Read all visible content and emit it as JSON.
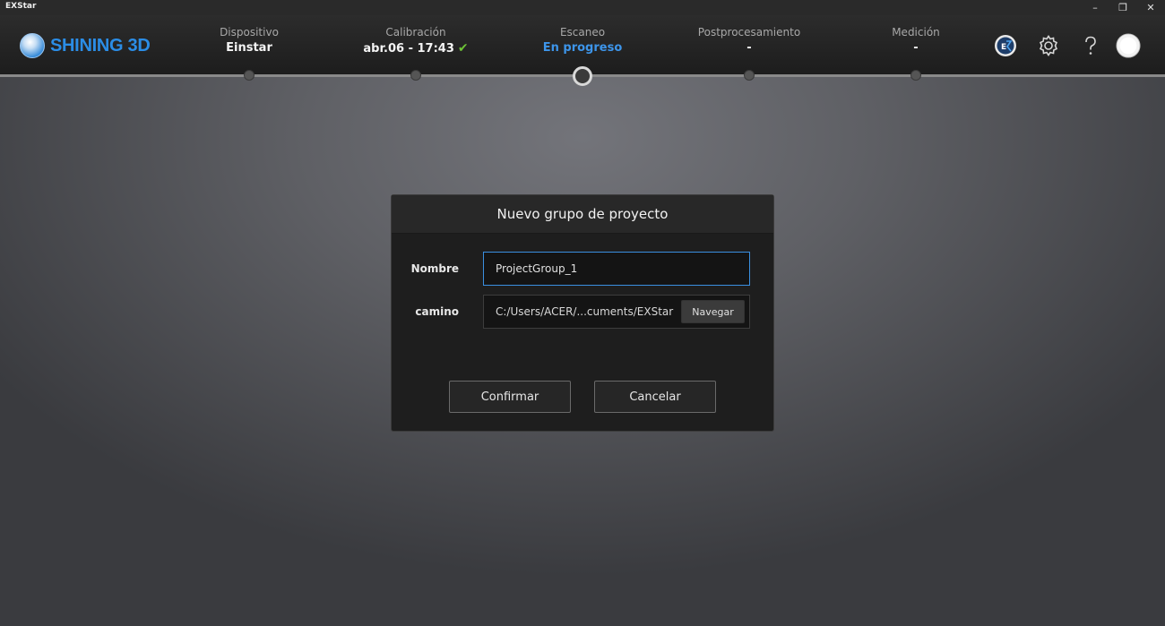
{
  "window": {
    "title": "EXStar",
    "controls": {
      "minimize": "–",
      "restore": "❐",
      "close": "✕"
    }
  },
  "header": {
    "brand": "SHINING 3D",
    "steps": [
      {
        "label": "Dispositivo",
        "value": "Einstar"
      },
      {
        "label": "Calibración",
        "value": "abr.06 - 17:43"
      },
      {
        "label": "Escaneo",
        "value": "En progreso",
        "active": true
      },
      {
        "label": "Postprocesamiento",
        "value": "-"
      },
      {
        "label": "Medición",
        "value": "-"
      }
    ],
    "icons": [
      "exmodel-icon",
      "gear-icon",
      "help-icon",
      "avatar-icon"
    ],
    "accent_color": "#3d95ea",
    "check_color": "#6dc236"
  },
  "dialog": {
    "title": "Nuevo grupo de proyecto",
    "name_label": "Nombre",
    "name_value": "ProjectGroup_1",
    "path_label": "camino",
    "path_value": "C:/Users/ACER/...cuments/EXStar",
    "browse_label": "Navegar",
    "confirm_label": "Confirmar",
    "cancel_label": "Cancelar"
  }
}
